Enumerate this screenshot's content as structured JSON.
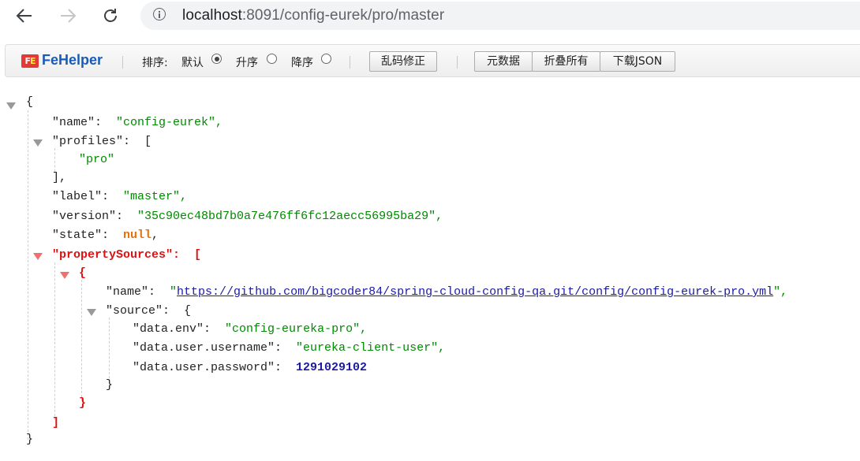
{
  "browser": {
    "url_host": "localhost",
    "url_path": ":8091/config-eurek/pro/master"
  },
  "toolbar": {
    "brand": "FeHelper",
    "sort_label": "排序:",
    "sort_default": "默认",
    "sort_asc": "升序",
    "sort_desc": "降序",
    "sort_selected": "默认",
    "fix_encoding": "乱码修正",
    "raw_data": "元数据",
    "collapse_all": "折叠所有",
    "download_json": "下载JSON"
  },
  "json": {
    "open_brace": "{",
    "close_brace": "}",
    "name_key": "\"name\":",
    "name_value": "\"config-eurek\",",
    "profiles_key": "\"profiles\":",
    "profiles_open": "[",
    "profiles_item": "\"pro\"",
    "profiles_close": "],",
    "label_key": "\"label\":",
    "label_value": "\"master\",",
    "version_key": "\"version\":",
    "version_value": "\"35c90ec48bd7b0a7e476ff6fc12aecc56995ba29\",",
    "state_key": "\"state\":",
    "state_value": "null",
    "comma": ",",
    "ps_key": "\"propertySources\":",
    "ps_open": "[",
    "ps_item_open": "{",
    "ps_name_key": "\"name\":",
    "ps_name_q1": "\"",
    "ps_name_url": "https://github.com/bigcoder84/spring-cloud-config-qa.git/config/config-eurek-pro.yml",
    "ps_name_q2": "\",",
    "source_key": "\"source\":",
    "source_open": "{",
    "env_key": "\"data.env\":",
    "env_value": "\"config-eureka-pro\",",
    "username_key": "\"data.user.username\":",
    "username_value": "\"eureka-client-user\",",
    "password_key": "\"data.user.password\":",
    "password_value": "1291029102",
    "source_close": "}",
    "ps_item_close": "}",
    "ps_close": "]",
    "root_close": "}"
  }
}
